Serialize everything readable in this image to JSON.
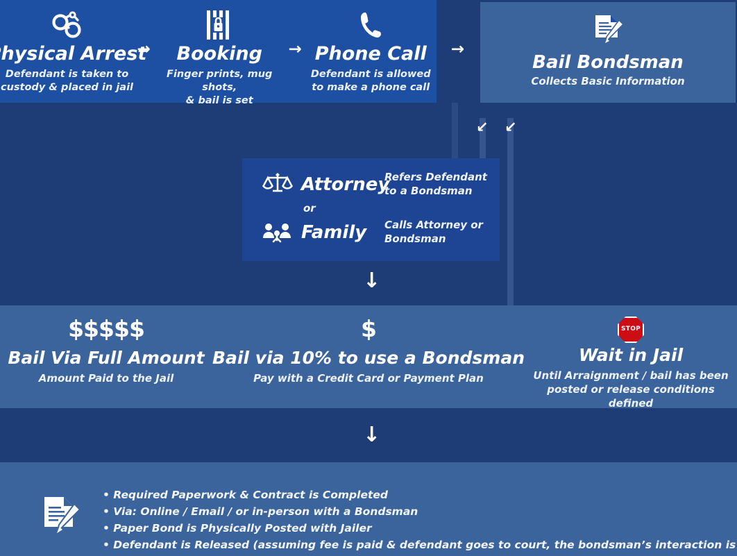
{
  "background_colors": {
    "page": "#1e3d77",
    "header_box": "#1d4fa3",
    "bondsman_box": "#3b639c",
    "attorney_box": "#1d4593",
    "options_row": "#3b639c",
    "bottom_box": "#3b639c",
    "stop_red": "#cc0d16"
  },
  "top_steps": [
    {
      "icon": "handcuffs-icon",
      "title": "Physical Arrest",
      "desc_line1": "Defendant is taken to",
      "desc_line2": "custody & placed in jail"
    },
    {
      "icon": "jail-bars-lock-icon",
      "title": "Booking",
      "desc_line1": "Finger prints, mug shots,",
      "desc_line2": "& bail is set"
    },
    {
      "icon": "phone-icon",
      "title": "Phone Call",
      "desc_line1": "Defendant is allowed",
      "desc_line2": "to make a phone call"
    }
  ],
  "arrow_glyph": "→",
  "down_arrow_glyph": "↓",
  "diag_arrow_glyph": "↙",
  "bondsman": {
    "icon": "document-pen-icon",
    "title": "Bail Bondsman",
    "subtitle": "Collects Basic Information"
  },
  "attorney": {
    "or_label": "or",
    "rows": [
      {
        "icon": "scales-icon",
        "name": "Attorney",
        "note_line1": "Refers Defendant",
        "note_line2": "to a Bondsman"
      },
      {
        "icon": "family-people-icon",
        "name": "Family",
        "note_line1": "Calls Attorney or",
        "note_line2": "Bondsman"
      }
    ]
  },
  "bail_options": [
    {
      "symbol": "$$$$$",
      "icon": "dollar-signs",
      "title": "Bail Via Full Amount",
      "desc_line1": "Amount Paid to the Jail",
      "desc_line2": ""
    },
    {
      "symbol": "$",
      "icon": "dollar-sign",
      "title": "Bail via 10% to use a Bondsman",
      "desc_line1": "Pay with a Credit Card or Payment Plan",
      "desc_line2": ""
    },
    {
      "symbol": "STOP",
      "icon": "stop-sign-icon",
      "title": "Wait in Jail",
      "desc_line1": "Until Arraignment / bail has been",
      "desc_line2": "posted or release conditions defined"
    }
  ],
  "bottom": {
    "icon": "document-pen-icon",
    "bullets": [
      "• Required Paperwork & Contract is Completed",
      "• Via: Online / Email / or in-person with a Bondsman",
      "• Paper Bond is Physically Posted with  Jailer",
      "• Defendant is Released (assuming fee is paid & defendant goes to court, the bondsman’s interaction is complete"
    ]
  }
}
